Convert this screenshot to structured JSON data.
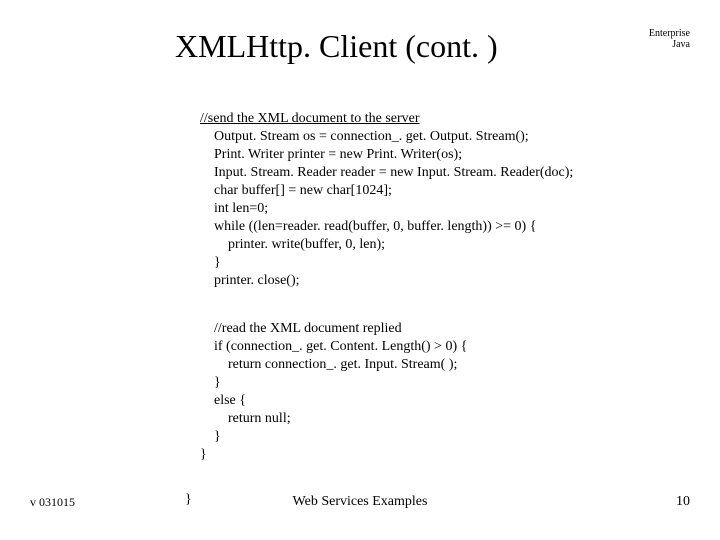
{
  "header": {
    "line1": "Enterprise",
    "line2": "Java"
  },
  "title": "XMLHttp. Client (cont. )",
  "code1": {
    "l0": "//send the XML document to the server",
    "l1": "    Output. Stream os = connection_. get. Output. Stream();",
    "l2": "    Print. Writer printer = new Print. Writer(os);",
    "l3": "    Input. Stream. Reader reader = new Input. Stream. Reader(doc);",
    "l4": "    char buffer[] = new char[1024];",
    "l5": "    int len=0;",
    "l6": "    while ((len=reader. read(buffer, 0, buffer. length)) >= 0) {",
    "l7": "        printer. write(buffer, 0, len);",
    "l8": "    }",
    "l9": "    printer. close();"
  },
  "code2": {
    "l0": "    //read the XML document replied",
    "l1": "    if (connection_. get. Content. Length() > 0) {",
    "l2": "        return connection_. get. Input. Stream( );",
    "l3": "    }",
    "l4": "    else {",
    "l5": "        return null;",
    "l6": "    }",
    "l7": "}"
  },
  "close_brace": "}",
  "footer": {
    "left": "v 031015",
    "center": "Web Services Examples",
    "right": "10"
  }
}
